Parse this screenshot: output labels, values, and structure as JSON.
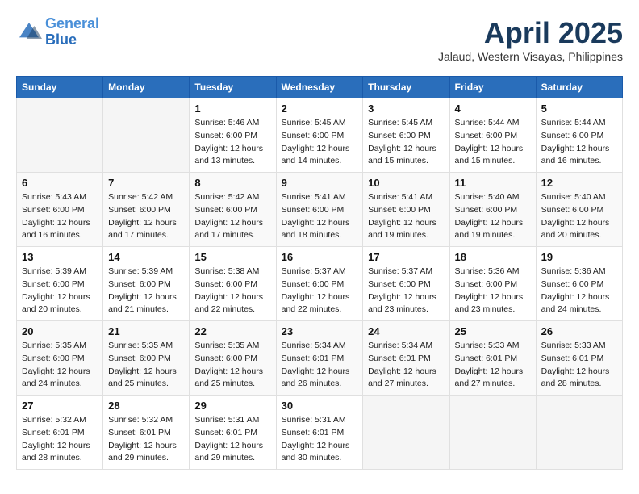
{
  "header": {
    "logo_line1": "General",
    "logo_line2": "Blue",
    "title": "April 2025",
    "subtitle": "Jalaud, Western Visayas, Philippines"
  },
  "weekdays": [
    "Sunday",
    "Monday",
    "Tuesday",
    "Wednesday",
    "Thursday",
    "Friday",
    "Saturday"
  ],
  "weeks": [
    [
      {
        "day": "",
        "info": ""
      },
      {
        "day": "",
        "info": ""
      },
      {
        "day": "1",
        "info": "Sunrise: 5:46 AM\nSunset: 6:00 PM\nDaylight: 12 hours and 13 minutes."
      },
      {
        "day": "2",
        "info": "Sunrise: 5:45 AM\nSunset: 6:00 PM\nDaylight: 12 hours and 14 minutes."
      },
      {
        "day": "3",
        "info": "Sunrise: 5:45 AM\nSunset: 6:00 PM\nDaylight: 12 hours and 15 minutes."
      },
      {
        "day": "4",
        "info": "Sunrise: 5:44 AM\nSunset: 6:00 PM\nDaylight: 12 hours and 15 minutes."
      },
      {
        "day": "5",
        "info": "Sunrise: 5:44 AM\nSunset: 6:00 PM\nDaylight: 12 hours and 16 minutes."
      }
    ],
    [
      {
        "day": "6",
        "info": "Sunrise: 5:43 AM\nSunset: 6:00 PM\nDaylight: 12 hours and 16 minutes."
      },
      {
        "day": "7",
        "info": "Sunrise: 5:42 AM\nSunset: 6:00 PM\nDaylight: 12 hours and 17 minutes."
      },
      {
        "day": "8",
        "info": "Sunrise: 5:42 AM\nSunset: 6:00 PM\nDaylight: 12 hours and 17 minutes."
      },
      {
        "day": "9",
        "info": "Sunrise: 5:41 AM\nSunset: 6:00 PM\nDaylight: 12 hours and 18 minutes."
      },
      {
        "day": "10",
        "info": "Sunrise: 5:41 AM\nSunset: 6:00 PM\nDaylight: 12 hours and 19 minutes."
      },
      {
        "day": "11",
        "info": "Sunrise: 5:40 AM\nSunset: 6:00 PM\nDaylight: 12 hours and 19 minutes."
      },
      {
        "day": "12",
        "info": "Sunrise: 5:40 AM\nSunset: 6:00 PM\nDaylight: 12 hours and 20 minutes."
      }
    ],
    [
      {
        "day": "13",
        "info": "Sunrise: 5:39 AM\nSunset: 6:00 PM\nDaylight: 12 hours and 20 minutes."
      },
      {
        "day": "14",
        "info": "Sunrise: 5:39 AM\nSunset: 6:00 PM\nDaylight: 12 hours and 21 minutes."
      },
      {
        "day": "15",
        "info": "Sunrise: 5:38 AM\nSunset: 6:00 PM\nDaylight: 12 hours and 22 minutes."
      },
      {
        "day": "16",
        "info": "Sunrise: 5:37 AM\nSunset: 6:00 PM\nDaylight: 12 hours and 22 minutes."
      },
      {
        "day": "17",
        "info": "Sunrise: 5:37 AM\nSunset: 6:00 PM\nDaylight: 12 hours and 23 minutes."
      },
      {
        "day": "18",
        "info": "Sunrise: 5:36 AM\nSunset: 6:00 PM\nDaylight: 12 hours and 23 minutes."
      },
      {
        "day": "19",
        "info": "Sunrise: 5:36 AM\nSunset: 6:00 PM\nDaylight: 12 hours and 24 minutes."
      }
    ],
    [
      {
        "day": "20",
        "info": "Sunrise: 5:35 AM\nSunset: 6:00 PM\nDaylight: 12 hours and 24 minutes."
      },
      {
        "day": "21",
        "info": "Sunrise: 5:35 AM\nSunset: 6:00 PM\nDaylight: 12 hours and 25 minutes."
      },
      {
        "day": "22",
        "info": "Sunrise: 5:35 AM\nSunset: 6:00 PM\nDaylight: 12 hours and 25 minutes."
      },
      {
        "day": "23",
        "info": "Sunrise: 5:34 AM\nSunset: 6:01 PM\nDaylight: 12 hours and 26 minutes."
      },
      {
        "day": "24",
        "info": "Sunrise: 5:34 AM\nSunset: 6:01 PM\nDaylight: 12 hours and 27 minutes."
      },
      {
        "day": "25",
        "info": "Sunrise: 5:33 AM\nSunset: 6:01 PM\nDaylight: 12 hours and 27 minutes."
      },
      {
        "day": "26",
        "info": "Sunrise: 5:33 AM\nSunset: 6:01 PM\nDaylight: 12 hours and 28 minutes."
      }
    ],
    [
      {
        "day": "27",
        "info": "Sunrise: 5:32 AM\nSunset: 6:01 PM\nDaylight: 12 hours and 28 minutes."
      },
      {
        "day": "28",
        "info": "Sunrise: 5:32 AM\nSunset: 6:01 PM\nDaylight: 12 hours and 29 minutes."
      },
      {
        "day": "29",
        "info": "Sunrise: 5:31 AM\nSunset: 6:01 PM\nDaylight: 12 hours and 29 minutes."
      },
      {
        "day": "30",
        "info": "Sunrise: 5:31 AM\nSunset: 6:01 PM\nDaylight: 12 hours and 30 minutes."
      },
      {
        "day": "",
        "info": ""
      },
      {
        "day": "",
        "info": ""
      },
      {
        "day": "",
        "info": ""
      }
    ]
  ]
}
